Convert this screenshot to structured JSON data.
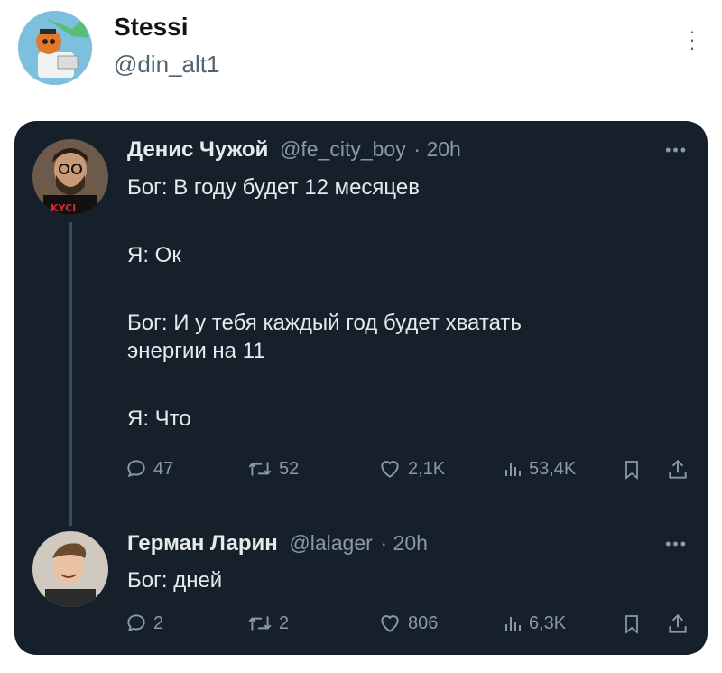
{
  "outer": {
    "name": "Stessi",
    "handle": "@din_alt1",
    "more": "⋮"
  },
  "tweets": [
    {
      "author": "Денис Чужой",
      "handle": "@fe_city_boy",
      "time": "· 20h",
      "lines": [
        "Бог: В году будет 12 месяцев",
        "",
        "Я: Ок",
        "",
        "Бог: И у тебя каждый год будет хватать",
        "энергии на 11",
        "",
        "Я: Что"
      ],
      "shirt_text": "KYCI",
      "replies": "47",
      "retweets": "52",
      "likes": "2,1K",
      "views": "53,4K"
    },
    {
      "author": "Герман Ларин",
      "handle": "@lalager",
      "time": "· 20h",
      "lines": [
        "Бог: дней"
      ],
      "replies": "2",
      "retweets": "2",
      "likes": "806",
      "views": "6,3K"
    }
  ],
  "icons": {
    "reply": "reply-icon",
    "retweet": "retweet-icon",
    "like": "heart-icon",
    "views": "views-icon",
    "bookmark": "bookmark-icon",
    "share": "share-icon"
  },
  "colors": {
    "card_bg": "#15202b",
    "text_primary": "#e7e9ea",
    "text_secondary": "#8b98a5"
  }
}
